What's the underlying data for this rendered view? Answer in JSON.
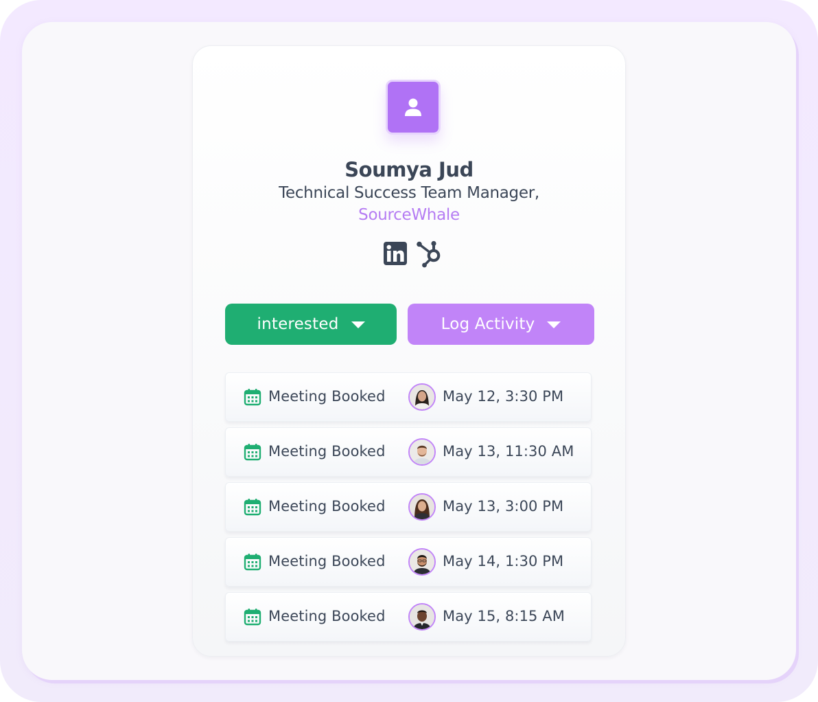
{
  "contact": {
    "avatar_icon": "user-icon",
    "name": "Soumya Jud",
    "title": "Technical Success Team Manager,",
    "company": "SourceWhale",
    "company_color": "#b57cf3",
    "social_icons": [
      "linkedin-icon",
      "hubspot-icon"
    ]
  },
  "actions": {
    "status_label": "interested",
    "status_color": "#1fae72",
    "log_label": "Log Activity",
    "log_color": "#c184f8"
  },
  "activities": [
    {
      "icon": "calendar-icon",
      "label": "Meeting Booked",
      "avatar": "user-avatar",
      "time": "May 12, 3:30 PM"
    },
    {
      "icon": "calendar-icon",
      "label": "Meeting Booked",
      "avatar": "user-avatar",
      "time": "May 13, 11:30 AM"
    },
    {
      "icon": "calendar-icon",
      "label": "Meeting Booked",
      "avatar": "user-avatar",
      "time": "May 13, 3:00 PM"
    },
    {
      "icon": "calendar-icon",
      "label": "Meeting Booked",
      "avatar": "user-avatar",
      "time": "May 14, 1:30 PM"
    },
    {
      "icon": "calendar-icon",
      "label": "Meeting Booked",
      "avatar": "user-avatar",
      "time": "May 15, 8:15 AM"
    }
  ]
}
